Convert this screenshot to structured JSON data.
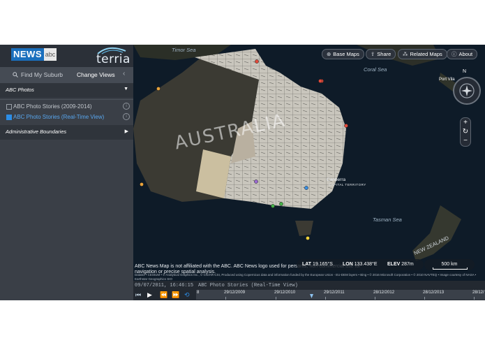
{
  "sidebar": {
    "brand": {
      "news": "NEWS",
      "abc": "abc",
      "terria": "terria"
    },
    "find_my_suburb": "Find My Suburb",
    "change_views": "Change Views",
    "sections": [
      {
        "title": "ABC Photos",
        "expanded": true,
        "layers": [
          {
            "label": "ABC Photo Stories (2009-2014)",
            "checked": false
          },
          {
            "label": "ABC Photo Stories (Real-Time View)",
            "checked": true
          }
        ]
      },
      {
        "title": "Administrative Boundaries",
        "expanded": false
      }
    ]
  },
  "toolbar": {
    "base_maps": "Base Maps",
    "share": "Share",
    "related_maps": "Related Maps",
    "about": "About"
  },
  "map": {
    "labels": {
      "australia": "AUSTRALIA",
      "coral_sea": "Coral Sea",
      "tasman_sea": "Tasman Sea",
      "timor_sea": "Timor Sea",
      "new_zealand": "NEW ZEALAND",
      "canberra": "Canberra",
      "capital_territory": "CAPITAL TERRITORY",
      "port_vila": "Port Vila"
    },
    "compass_north": "N",
    "disclaimer": "ABC News Map is not affiliated with the ABC. ABC News logo used for personal, non-commercial use for navigation or precise spatial analysis.",
    "credits": "Data61 • CESIUM • © Analytical Graphics Inc., © CGIAR-CSI, Produced using Copernicus data and information funded by the European Union - EU-DEM layers • Bing • © 2016 Microsoft Corporation • © 2010 NAVTEQ • Image courtesy of NASA • Earthstar Geographics SIO",
    "coords": {
      "lat_label": "LAT",
      "lat": "19.165°S",
      "lon_label": "LON",
      "lon": "133.438°E",
      "elev_label": "ELEV",
      "elev": "287m"
    },
    "scale": "500 km",
    "colors": {
      "ocean": "#0e1b28",
      "land": "#3b3a33",
      "boundaries": "#d9d9d9",
      "accent": "#2c8de6"
    },
    "markers": [
      {
        "color": "#e24a3b"
      },
      {
        "color": "#e24a3b"
      },
      {
        "color": "#e24a3b"
      },
      {
        "color": "#e8a23a"
      },
      {
        "color": "#e8a23a"
      },
      {
        "color": "#47b04a"
      },
      {
        "color": "#47b04a"
      },
      {
        "color": "#9a6ad0"
      },
      {
        "color": "#3a8ee0"
      },
      {
        "color": "#f0d23a"
      },
      {
        "color": "#e24a3b"
      }
    ]
  },
  "timeline": {
    "current_time": "09/07/2011, 16:46:15",
    "layer_name": "ABC Photo Stories (Real-Time View)",
    "dates": [
      "29/12/2009",
      "29/12/2010",
      "29/12/2011",
      "28/12/2012",
      "28/12/2013",
      "28/12/"
    ],
    "start_tick": "8"
  }
}
